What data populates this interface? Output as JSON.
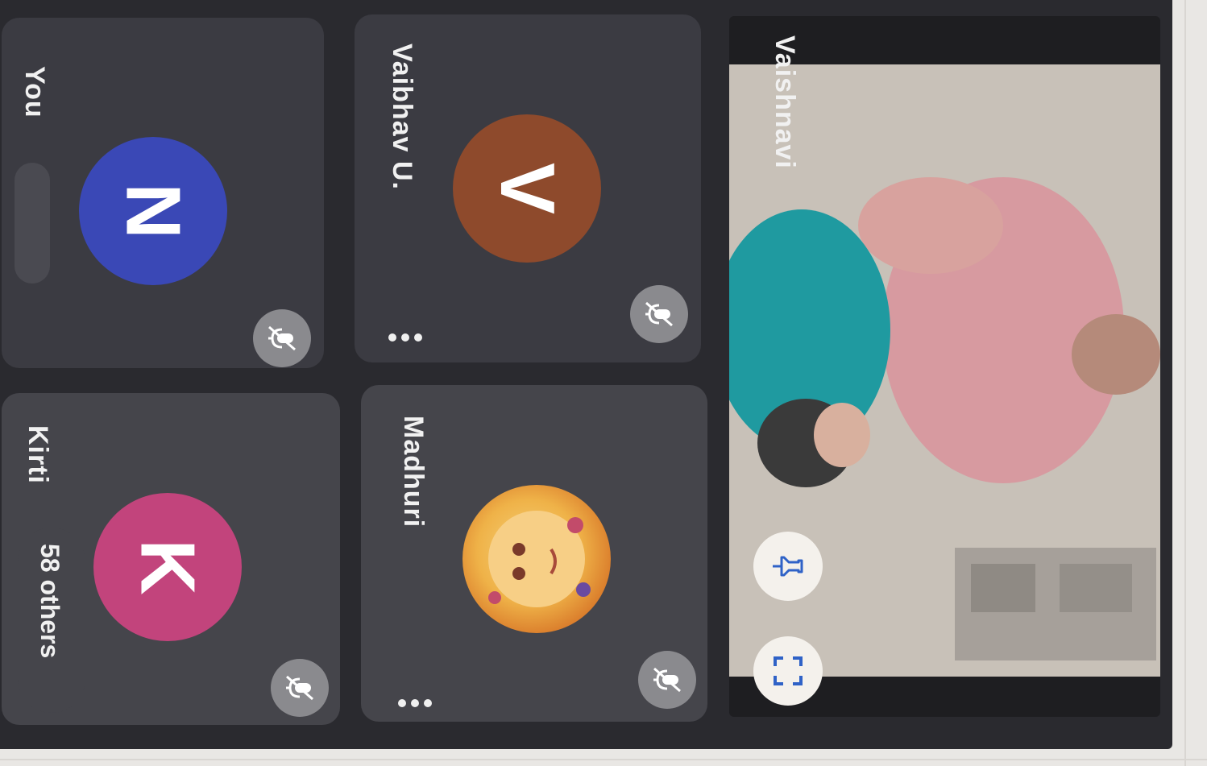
{
  "participants": [
    {
      "name": "Vaibhav U.",
      "initial": "V",
      "color": "#8e4a2c",
      "muted": true,
      "has_menu": true
    },
    {
      "name": "Madhuri",
      "initial": "",
      "color": "#e0a33a",
      "muted": true,
      "has_menu": true
    },
    {
      "name": "You",
      "initial": "N",
      "color": "#3a48b6",
      "muted": true,
      "has_menu": false
    },
    {
      "name": "Kirti",
      "initial": "K",
      "color": "#c2447c",
      "muted": true,
      "has_menu": false
    }
  ],
  "others_count_label": "58 others",
  "pinned_video": {
    "name": "Vaishnavi",
    "pin_icon": "pin-icon",
    "fullscreen_icon": "fullscreen-icon"
  },
  "colors": {
    "background": "#2a2a2f",
    "tile": "#3b3b42",
    "mute_badge": "#8a8a8e",
    "icon_accent": "#2f62c7"
  }
}
